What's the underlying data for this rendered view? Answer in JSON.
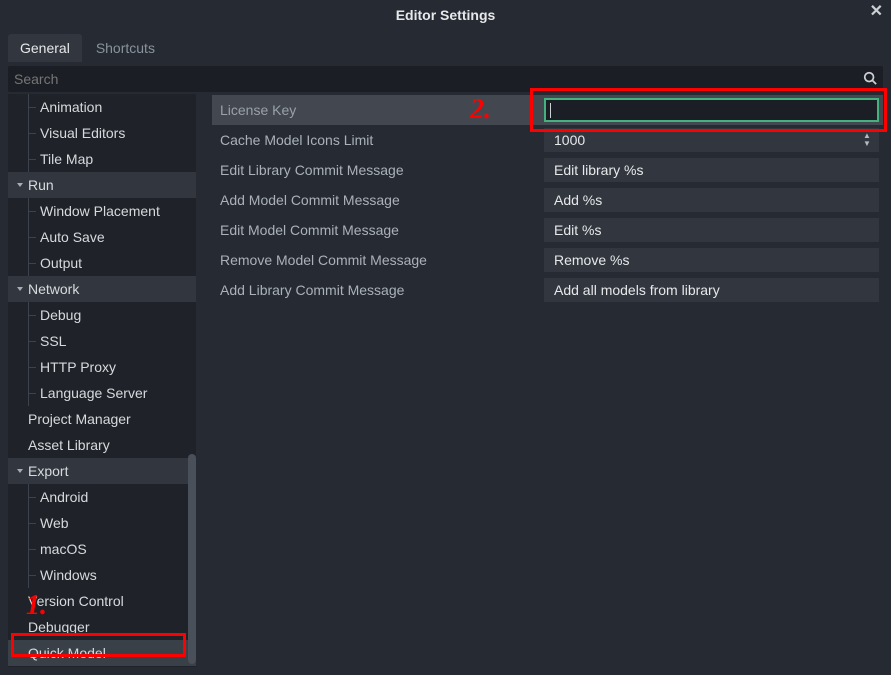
{
  "window": {
    "title": "Editor Settings"
  },
  "tabs": {
    "general": "General",
    "shortcuts": "Shortcuts"
  },
  "search": {
    "placeholder": "Search"
  },
  "tree": {
    "animation": "Animation",
    "visual_editors": "Visual Editors",
    "tile_map": "Tile Map",
    "run": "Run",
    "window_placement": "Window Placement",
    "auto_save": "Auto Save",
    "output": "Output",
    "network": "Network",
    "debug": "Debug",
    "ssl": "SSL",
    "http_proxy": "HTTP Proxy",
    "language_server": "Language Server",
    "project_manager": "Project Manager",
    "asset_library": "Asset Library",
    "export": "Export",
    "android": "Android",
    "web": "Web",
    "macos": "macOS",
    "windows": "Windows",
    "version_control": "Version Control",
    "debugger": "Debugger",
    "quick_model": "Quick Model"
  },
  "settings": {
    "license_key": {
      "label": "License Key",
      "value": ""
    },
    "cache_limit": {
      "label": "Cache Model Icons Limit",
      "value": "1000"
    },
    "edit_lib": {
      "label": "Edit Library Commit Message",
      "value": "Edit library %s"
    },
    "add_model": {
      "label": "Add Model Commit Message",
      "value": "Add %s"
    },
    "edit_model": {
      "label": "Edit Model Commit Message",
      "value": "Edit %s"
    },
    "remove_model": {
      "label": "Remove Model Commit Message",
      "value": "Remove %s"
    },
    "add_lib": {
      "label": "Add Library Commit Message",
      "value": "Add all models from library"
    }
  },
  "annotations": {
    "one": "1.",
    "two": "2."
  }
}
